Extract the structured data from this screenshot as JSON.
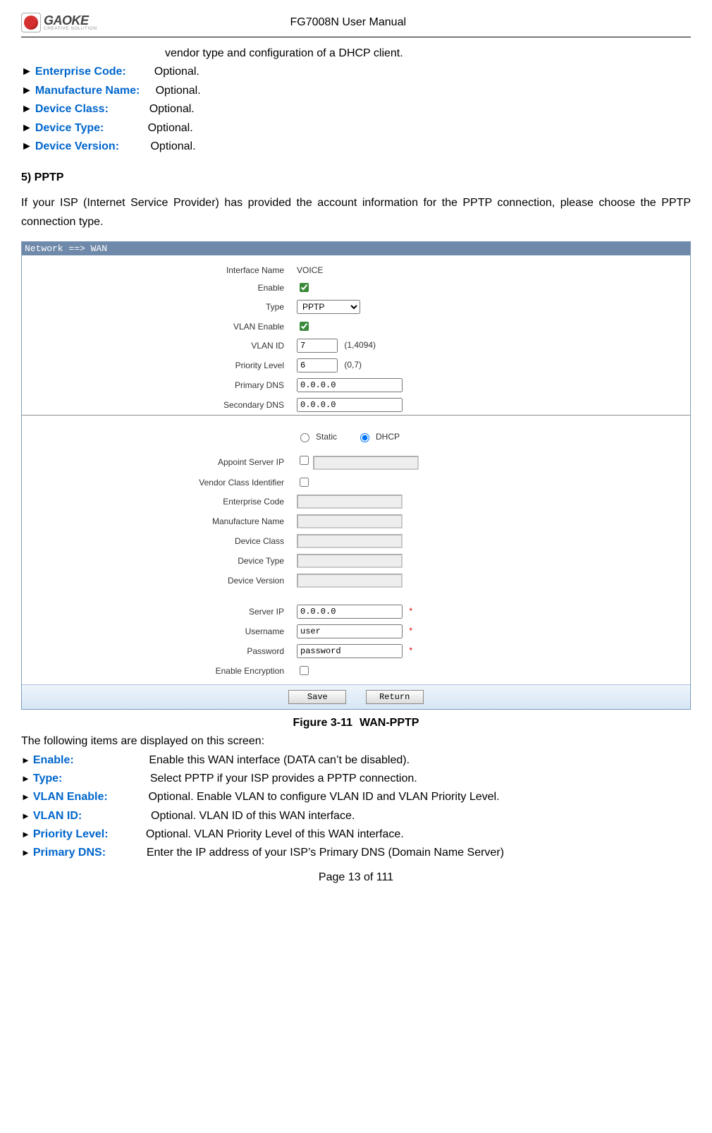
{
  "header": {
    "title": "FG7008N User Manual",
    "logo_text": "GAOKE",
    "logo_sub": "CREATIVE SOLUTION"
  },
  "intro": {
    "cont_line": "vendor type and configuration of a DHCP client.",
    "items": [
      {
        "term": "Enterprise Code:",
        "pad": "         ",
        "desc": "Optional."
      },
      {
        "term": "Manufacture Name:",
        "pad": "     ",
        "desc": "Optional."
      },
      {
        "term": "Device Class:",
        "pad": "             ",
        "desc": "Optional."
      },
      {
        "term": "Device Type:",
        "pad": "              ",
        "desc": "Optional."
      },
      {
        "term": "Device Version:",
        "pad": "          ",
        "desc": "Optional."
      }
    ]
  },
  "section": {
    "heading": "5) PPTP",
    "para": "If your ISP (Internet Service Provider) has provided the account information for the PPTP connection, please choose the PPTP connection type."
  },
  "figure": {
    "breadcrumb": "Network ==> WAN",
    "caption_no": "Figure 3-11",
    "caption_title": "WAN-PPTP",
    "labels": {
      "interface_name": "Interface Name",
      "enable": "Enable",
      "type": "Type",
      "vlan_enable": "VLAN Enable",
      "vlan_id": "VLAN ID",
      "priority_level": "Priority Level",
      "primary_dns": "Primary DNS",
      "secondary_dns": "Secondary DNS",
      "appoint_server_ip": "Appoint Server IP",
      "vendor_class_identifier": "Vendor Class Identifier",
      "enterprise_code": "Enterprise Code",
      "manufacture_name": "Manufacture Name",
      "device_class": "Device Class",
      "device_type": "Device Type",
      "device_version": "Device Version",
      "server_ip": "Server IP",
      "username": "Username",
      "password": "Password",
      "enable_encryption": "Enable Encryption",
      "static": "Static",
      "dhcp": "DHCP"
    },
    "values": {
      "interface_name": "VOICE",
      "type": "PPTP",
      "vlan_id": "7",
      "vlan_id_hint": "(1,4094)",
      "priority_level": "6",
      "priority_hint": "(0,7)",
      "primary_dns": "0.0.0.0",
      "secondary_dns": "0.0.0.0",
      "server_ip": "0.0.0.0",
      "username": "user",
      "password": "password"
    },
    "buttons": {
      "save": "Save",
      "return": "Return"
    },
    "req_mark": "*"
  },
  "after": {
    "lead": "The following items are displayed on this screen:",
    "items": [
      {
        "term": "Enable:",
        "pad": "                        ",
        "desc": "Enable this WAN interface (DATA can’t be disabled)."
      },
      {
        "term": "Type:",
        "pad": "                            ",
        "desc": "Select PPTP if your ISP provides a PPTP connection."
      },
      {
        "term": "VLAN Enable:",
        "pad": "             ",
        "desc": "Optional. Enable VLAN to configure VLAN ID and VLAN Priority Level."
      },
      {
        "term": "VLAN ID:",
        "pad": "                      ",
        "desc": "Optional. VLAN ID of this WAN interface."
      },
      {
        "term": "Priority Level:",
        "pad": "            ",
        "desc": "Optional. VLAN Priority Level of this WAN interface."
      },
      {
        "term": "Primary DNS:",
        "pad": "             ",
        "desc": "Enter the IP address of your ISP’s Primary DNS (Domain Name Server)"
      }
    ]
  },
  "footer": {
    "page": "Page 13 of 111"
  }
}
